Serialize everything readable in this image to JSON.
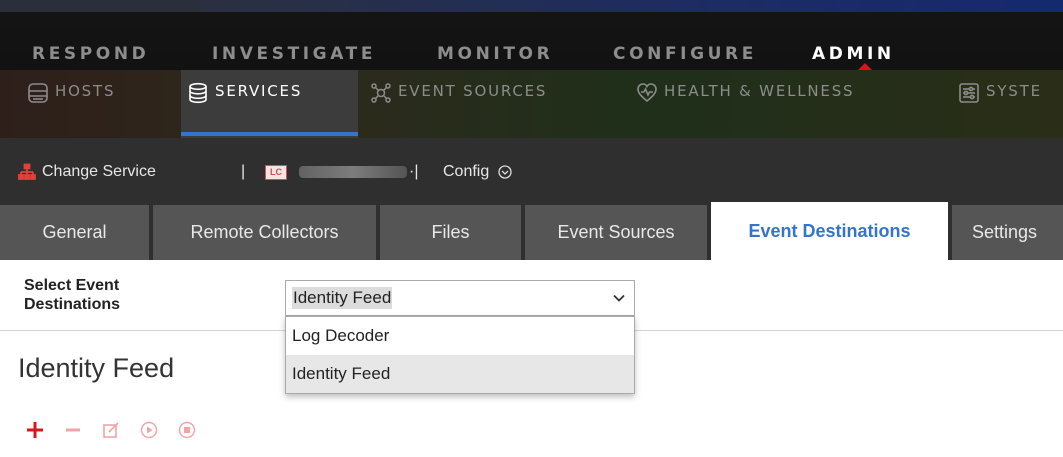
{
  "main_nav": {
    "items": [
      {
        "label": "RESPOND",
        "active": false
      },
      {
        "label": "INVESTIGATE",
        "active": false
      },
      {
        "label": "MONITOR",
        "active": false
      },
      {
        "label": "CONFIGURE",
        "active": false
      },
      {
        "label": "ADMIN",
        "active": true
      }
    ],
    "active_indicator_color": "#e10e1c"
  },
  "sub_nav": {
    "items": [
      {
        "label": "HOSTS",
        "icon": "hosts-icon",
        "active": false
      },
      {
        "label": "SERVICES",
        "icon": "database-icon",
        "active": true
      },
      {
        "label": "EVENT SOURCES",
        "icon": "event-sources-icon",
        "active": false
      },
      {
        "label": "HEALTH & WELLNESS",
        "icon": "heart-pulse-icon",
        "active": false
      },
      {
        "label": "SYSTE",
        "icon": "system-icon",
        "active": false
      }
    ],
    "active_underline_color": "#3574ce"
  },
  "service_bar": {
    "change_service": "Change Service",
    "separator": "|",
    "service_type_badge": "LC",
    "service_name_suffix": "·|",
    "config_label": "Config"
  },
  "config_tabs": [
    {
      "label": "General",
      "active": false
    },
    {
      "label": "Remote Collectors",
      "active": false
    },
    {
      "label": "Files",
      "active": false
    },
    {
      "label": "Event Sources",
      "active": false
    },
    {
      "label": "Event Destinations",
      "active": true
    },
    {
      "label": "Settings",
      "active": false
    }
  ],
  "destinations": {
    "select_label_line1": "Select Event",
    "select_label_line2": "Destinations",
    "selected_value": "Identity Feed",
    "options": [
      {
        "label": "Log Decoder",
        "highlighted": false
      },
      {
        "label": "Identity Feed",
        "highlighted": true
      }
    ]
  },
  "panel": {
    "title": "Identity Feed",
    "toolbar": [
      {
        "icon": "add-icon",
        "enabled": true
      },
      {
        "icon": "remove-icon",
        "enabled": false
      },
      {
        "icon": "edit-icon",
        "enabled": false
      },
      {
        "icon": "start-icon",
        "enabled": false
      },
      {
        "icon": "stop-icon",
        "enabled": false
      }
    ]
  },
  "colors": {
    "accent_blue": "#3574ce",
    "accent_red": "#e10e1c"
  }
}
